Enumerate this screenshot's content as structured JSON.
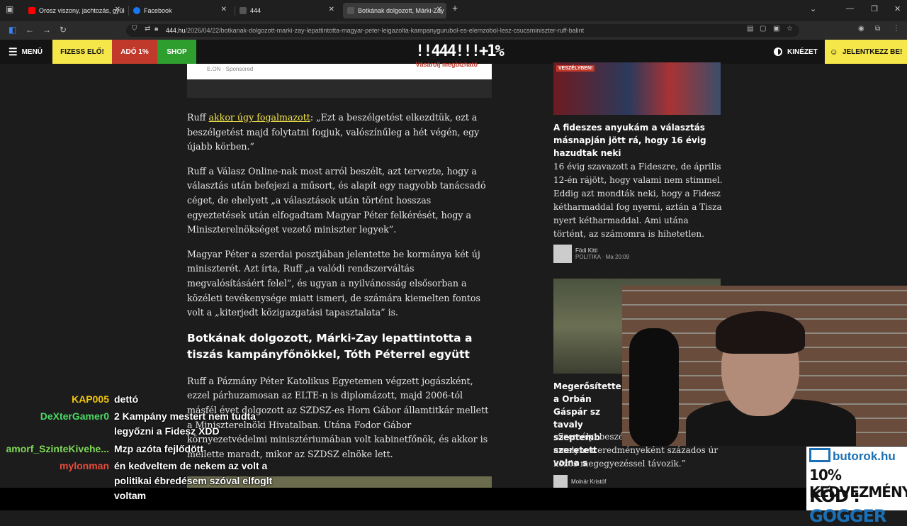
{
  "browser": {
    "tabs": [
      {
        "label": "Orosz viszony, jachtozás, gyűlö",
        "favicon_color": "#ff0000"
      },
      {
        "label": "Facebook",
        "favicon_color": "#1877f2"
      },
      {
        "label": "444",
        "favicon_color": "#444444"
      },
      {
        "label": "Botkának dolgozott, Márki-Zay",
        "favicon_color": "#444444"
      }
    ],
    "new_tab": "+",
    "url_host": "444.hu",
    "url_path": "/2026/04/22/botkanak-dolgozott-marki-zay-lepattintotta-magyar-peter-leigazolta-kampanygurubol-es-elemzobol-lesz-csucsminiszter-ruff-balint"
  },
  "header": {
    "menu_label": "MENÜ",
    "btn_fizess": "FIZESS ELŐ!",
    "btn_ado": "ADÓ 1%",
    "btn_shop": "SHOP",
    "logo": "!!444!!!+1%",
    "kinezet": "KINÉZET",
    "jelentkezz": "JELENTKEZZ BE!",
    "colors": {
      "fizess": "#f5e74a",
      "ado": "#c0392b",
      "shop": "#2e9e2e"
    }
  },
  "ad": {
    "sponsor": "E.ON · Sponsored",
    "red_text": "Vásárolj megbízható"
  },
  "article": {
    "p1_prefix": "Ruff ",
    "p1_link": "akkor úgy fogalmazott",
    "p1_rest": ": „Ezt a beszélgetést elkezdtük, ezt a beszélgetést majd folytatni fogjuk, valószínűleg a hét végén, egy újabb körben.”",
    "p2": "Ruff a Válasz Online-nak most arról beszélt, azt tervezte, hogy a választás után befejezi a műsort, és alapít egy nagyobb tanácsadó céget, de ehelyett „a választások után történt hosszas egyeztetések után elfogadtam Magyar Péter felkérését, hogy a Miniszterelnökséget vezető miniszter legyek”.",
    "p3": "Magyar Péter a szerdai posztjában jelentette be kormánya két új miniszterét. Azt írta, Ruff „a valódi rendszerváltás megvalósításáért felel”, és ugyan a nyilvánosság elsősorban a közéleti tevékenysége miatt ismeri, de számára kiemelten fontos volt a „kiterjedt közigazgatási tapasztalata” is.",
    "h2": "Botkának dolgozott, Márki-Zay lepattintotta a tiszás kampányfőnökkel, Tóth Péterrel együtt",
    "p4": "Ruff a Pázmány Péter Katolikus Egyetemen végzett jogászként, ezzel párhuzamosan az ELTE-n is diplomázott, majd 2006-tól másfél évet dolgozott az SZDSZ-es Horn Gábor államtitkár mellett a Miniszterelnöki Hivatalban. Utána Fodor Gábor környezetvédelmi minisztériumában volt kabinetfőnök, és akkor is mellette maradt, mikor az SZDSZ elnöke lett."
  },
  "sidebar": {
    "card1": {
      "badge": "VESZÉLYBEN!",
      "title": "A fideszes anyukám a választás másnapján jött rá, hogy 16 évig hazudtak neki",
      "lead": "16 évig szavazott a Fideszre, de április 12-én rájött, hogy valami nem stimmel. Eddig azt mondták neki, hogy a Fidesz kétharmaddal fog nyerni, aztán a Tisza nyert kétharmaddal. Ami utána történt, az számomra is hihetetlen.",
      "author": "Födi Kitti",
      "meta": "POLITIKA · Ma 20:09"
    },
    "card2": {
      "title": "Megerősítette a Orbán Gáspár sz tavaly szeptemb szeretett volna s",
      "lead": "„Személyi beszélg parancsnoka, amelynek eredményeként százados úr közös megegyezéssel távozik.”",
      "author": "Molnár Kristóf"
    }
  },
  "chat": [
    {
      "name": "KAP005",
      "color": "#f1c40f",
      "msg": "dettó"
    },
    {
      "name": "DeXterGamer0",
      "color": "#4cd964",
      "msg": "2 Kampány mestert nem tudta legyőzni a Fidesz XDD"
    },
    {
      "name": "amorf_SzinteKivehe...",
      "color": "#7ed957",
      "msg": "Mzp azóta fejlődött"
    },
    {
      "name": "mylonman",
      "color": "#e74c3c",
      "msg": "én kedveltem de nekem az volt a politikai ébredésem szóval elfoglt voltam"
    }
  ],
  "sponsor": {
    "brand": "butorok.hu",
    "line1": "10% KEDVEZMÉNY",
    "line2_prefix": "KÓD : ",
    "line2_code": "GOGGER"
  }
}
